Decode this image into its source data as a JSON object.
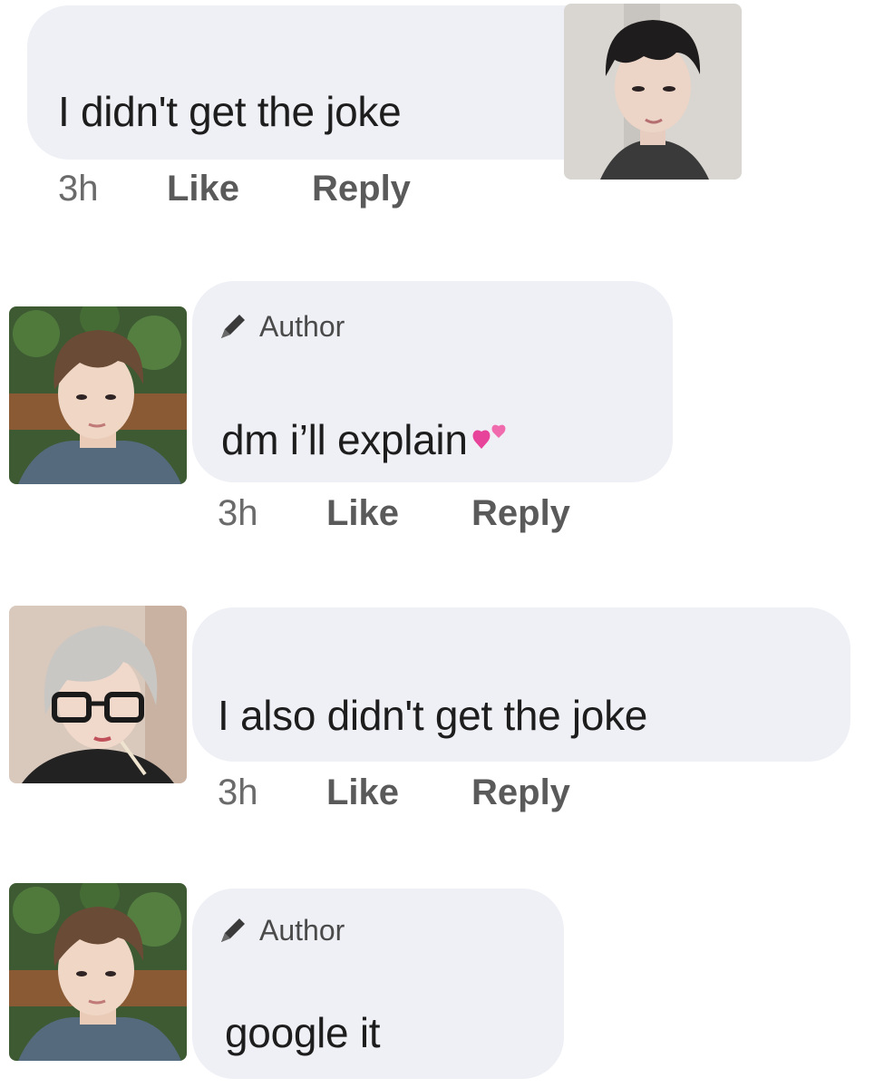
{
  "comments": [
    {
      "text": "I didn't get the joke",
      "time": "3h",
      "like_label": "Like",
      "reply_label": "Reply"
    },
    {
      "author_badge": "Author",
      "text": "dm i’ll explain",
      "emoji": "two-hearts",
      "time": "3h",
      "like_label": "Like",
      "reply_label": "Reply"
    },
    {
      "text": "I also didn't get the joke",
      "time": "3h",
      "like_label": "Like",
      "reply_label": "Reply"
    },
    {
      "author_badge": "Author",
      "text": "google it"
    }
  ],
  "icons": {
    "author_badge_icon": "pencil-icon",
    "emoji_icon": "two-hearts-icon"
  },
  "colors": {
    "bubble": "#eff0f5",
    "meta_text": "#5a5a5a",
    "heart": "#e8439a"
  }
}
